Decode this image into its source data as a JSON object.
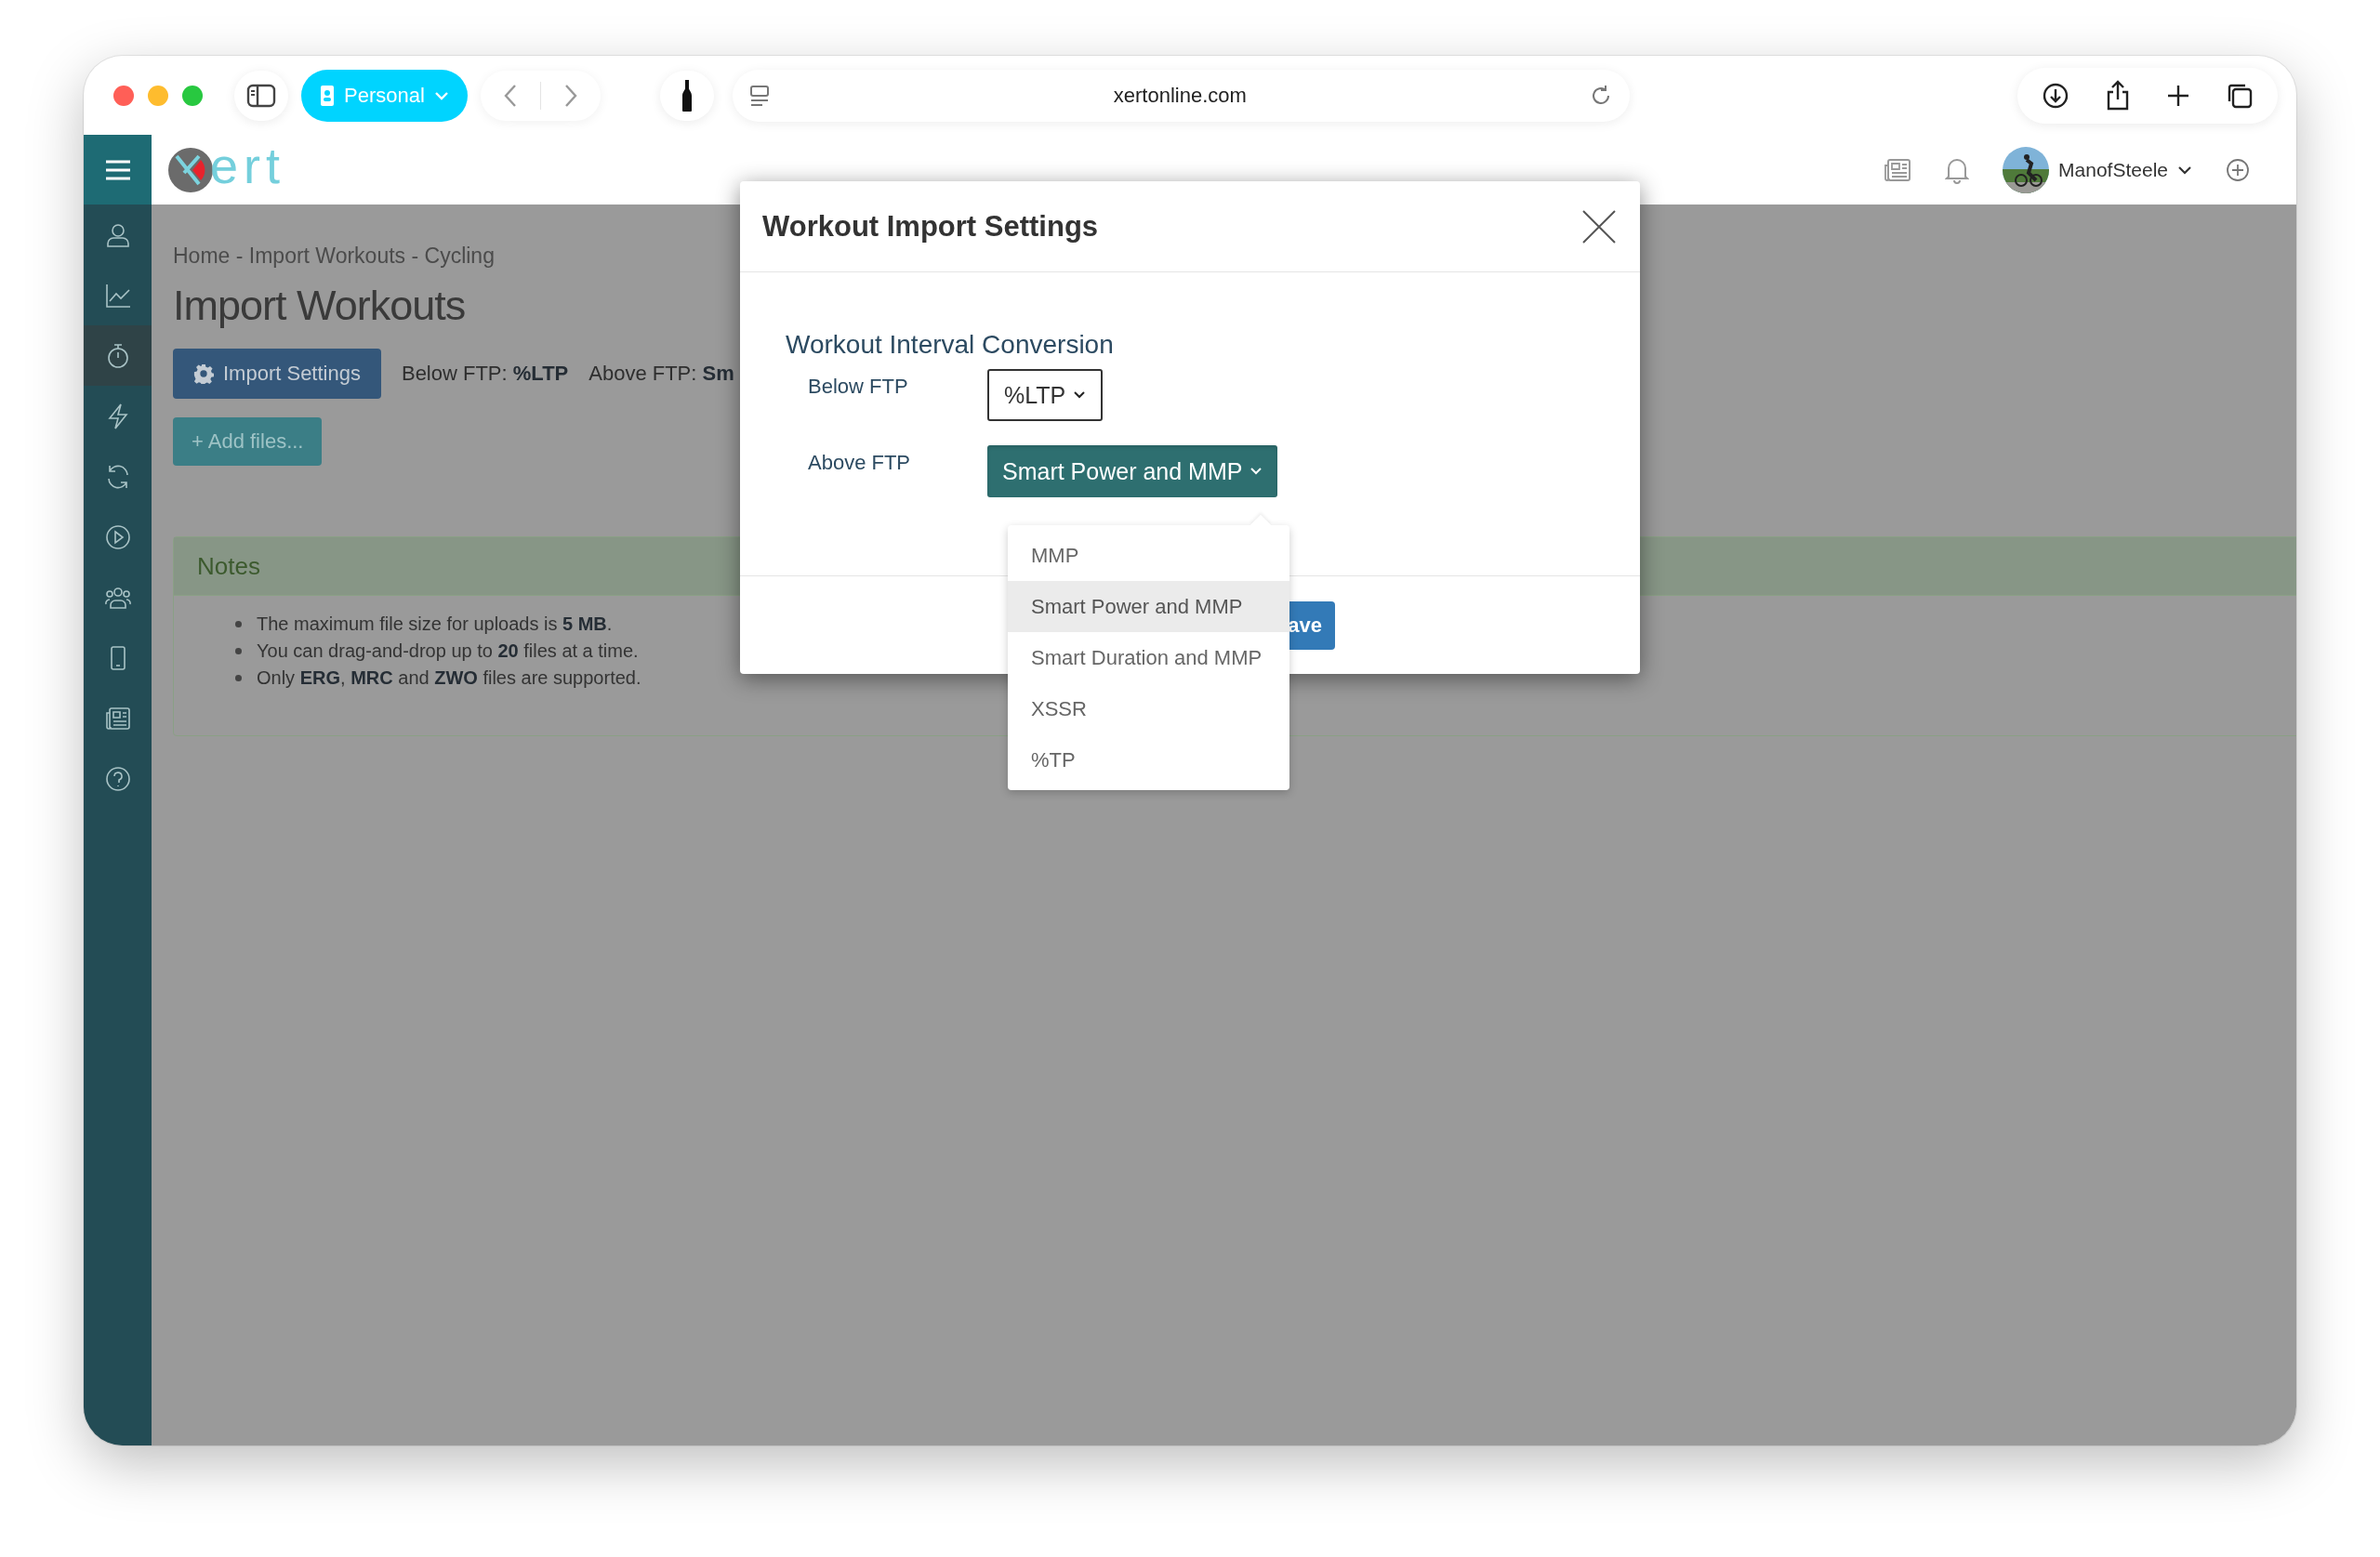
{
  "browser": {
    "profile": "Personal",
    "url": "xertonline.com"
  },
  "app_header": {
    "logo": "ert",
    "user": "ManofSteele"
  },
  "sidebar": {
    "items": [
      {
        "selected": false
      },
      {
        "selected": false
      },
      {
        "selected": true
      },
      {
        "selected": false
      },
      {
        "selected": false
      },
      {
        "selected": false
      },
      {
        "selected": false
      },
      {
        "selected": false
      },
      {
        "selected": false
      },
      {
        "selected": false
      }
    ]
  },
  "breadcrumb": "Home - Import Workouts - Cycling",
  "page_title": "Import Workouts",
  "import_settings_button": "Import Settings",
  "summary": [
    "Below FTP: **%LTP**",
    "Above FTP: **Sm**"
  ],
  "add_files_button": "+ Add files...",
  "notes": {
    "title": "Notes",
    "items": [
      "The maximum file size for uploads is **5 MB**.",
      "You can drag-and-drop up to **20** files at a time.",
      "Only **ERG**, **MRC** and **ZWO** files are supported."
    ]
  },
  "modal": {
    "title": "Workout Import Settings",
    "section": "Workout Interval Conversion",
    "fields": [
      {
        "label": "Below FTP",
        "value": "%LTP",
        "kind": "outline",
        "expanded": false
      },
      {
        "label": "Above FTP",
        "value": "Smart Power and MMP",
        "kind": "filled",
        "expanded": true
      }
    ],
    "save_button": "ave",
    "dropdown": [
      {
        "label": "MMP",
        "selected": false
      },
      {
        "label": "Smart Power and MMP",
        "selected": true
      },
      {
        "label": "Smart Duration and MMP",
        "selected": false
      },
      {
        "label": "XSSR",
        "selected": false
      },
      {
        "label": "%TP",
        "selected": false
      }
    ]
  }
}
